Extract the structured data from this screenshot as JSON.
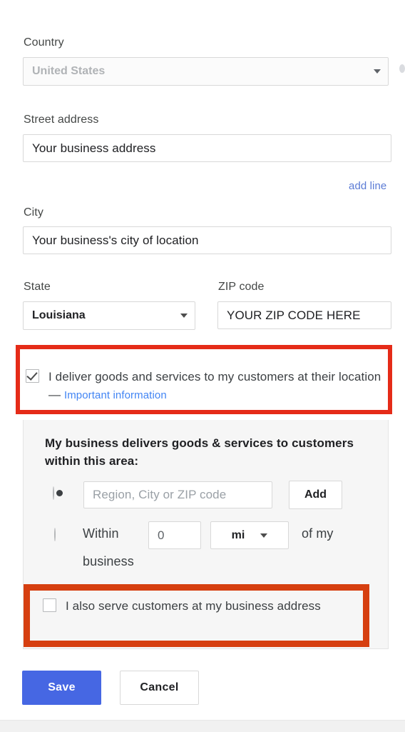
{
  "form": {
    "country": {
      "label": "Country",
      "value": "United States",
      "icon": "chevron-down-icon",
      "disabled": true
    },
    "street": {
      "label": "Street address",
      "value": "Your business address",
      "add_line_link": "add line"
    },
    "city": {
      "label": "City",
      "value": "Your business's city of location"
    },
    "state": {
      "label": "State",
      "value": "Louisiana",
      "icon": "chevron-down-icon"
    },
    "zip": {
      "label": "ZIP code",
      "value": "YOUR ZIP CODE HERE"
    },
    "delivery_checkbox": {
      "checked": true,
      "text": "I deliver goods and services to my customers at their location — ",
      "link_text": "Important information"
    },
    "service_area": {
      "heading": "My business delivers goods & services to customers within this area:",
      "region_option": {
        "selected": true,
        "placeholder": "Region, City or ZIP code",
        "add_label": "Add"
      },
      "radius_option": {
        "selected": false,
        "prefix": "Within",
        "distance": "0",
        "unit": "mi",
        "unit_icon": "chevron-down-icon",
        "suffix_line1": "of my",
        "suffix_line2": "business"
      },
      "also_serve_checkbox": {
        "checked": false,
        "text": "I also serve customers at my business address"
      }
    }
  },
  "actions": {
    "save_label": "Save",
    "cancel_label": "Cancel"
  },
  "colors": {
    "primary_button": "#4667e3",
    "link": "#4285f4",
    "highlight_red": "#e52b18",
    "highlight_orange": "#d63f10",
    "panel_background": "#f6f6f6"
  }
}
